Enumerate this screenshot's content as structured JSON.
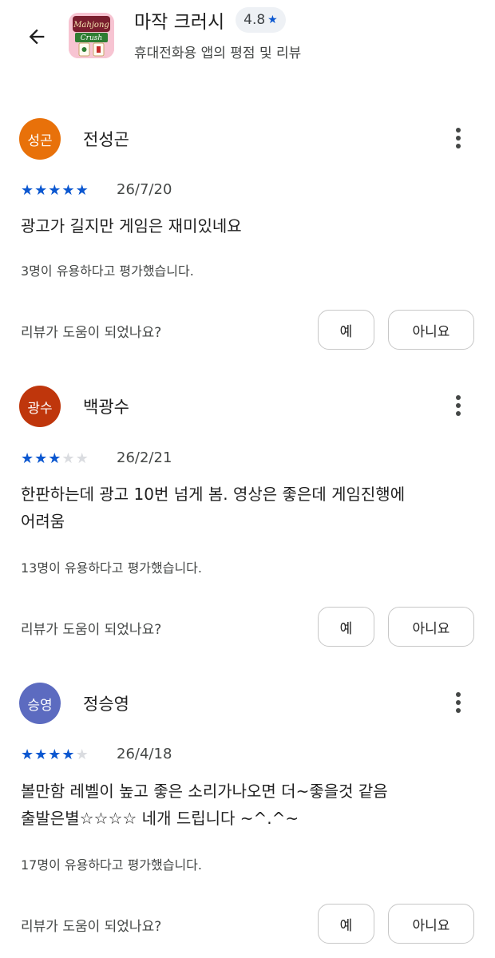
{
  "header": {
    "app_title": "마작 크러시",
    "rating": "4.8",
    "subtitle": "휴대전화용 앱의 평점 및 리뷰",
    "app_icon_text_1": "Mahjong",
    "app_icon_text_2": "Crush"
  },
  "reviews": [
    {
      "avatar_text": "성곤",
      "avatar_color": "#e8710a",
      "author": "전성곤",
      "stars": 5,
      "date": "26/7/20",
      "text_lines": [
        "광고가 길지만 게임은 재미있네요"
      ],
      "helpful": "3명이 유용하다고 평가했습니다.",
      "question": "리뷰가 도움이 되었나요?",
      "yes_label": "예",
      "no_label": "아니요"
    },
    {
      "avatar_text": "광수",
      "avatar_color": "#bf360c",
      "author": "백광수",
      "stars": 3,
      "date": "26/2/21",
      "text_lines": [
        "한판하는데 광고 10번 넘게 봄. 영상은 좋은데 게임진행에",
        "어려움"
      ],
      "helpful": "13명이 유용하다고 평가했습니다.",
      "question": "리뷰가 도움이 되었나요?",
      "yes_label": "예",
      "no_label": "아니요"
    },
    {
      "avatar_text": "승영",
      "avatar_color": "#5c6bc0",
      "author": "정승영",
      "stars": 4,
      "date": "26/4/18",
      "text_lines": [
        "볼만함 레벨이 높고 좋은 소리가나오면 더~좋을것 같음",
        "출발은별☆☆☆☆ 네개 드립니다 ~^.^~"
      ],
      "helpful": "17명이 유용하다고 평가했습니다.",
      "question": "리뷰가 도움이 되었나요?",
      "yes_label": "예",
      "no_label": "아니요"
    }
  ],
  "colors": {
    "star_filled": "#0b57d0",
    "star_empty": "#dadce0"
  }
}
